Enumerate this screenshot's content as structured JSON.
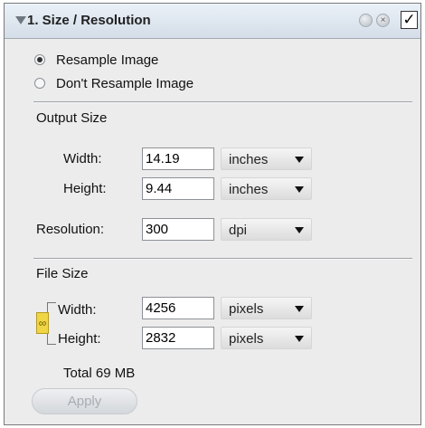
{
  "panel": {
    "title": "1. Size / Resolution",
    "close_glyph": "×",
    "enable_check": "✓"
  },
  "resample": {
    "options": [
      {
        "label": "Resample Image",
        "selected": true
      },
      {
        "label": "Don't Resample Image",
        "selected": false
      }
    ]
  },
  "output_size": {
    "label": "Output Size",
    "width": {
      "label": "Width:",
      "value": "14.19",
      "unit": "inches"
    },
    "height": {
      "label": "Height:",
      "value": "9.44",
      "unit": "inches"
    }
  },
  "resolution": {
    "label": "Resolution:",
    "value": "300",
    "unit": "dpi"
  },
  "file_size": {
    "label": "File Size",
    "width": {
      "label": "Width:",
      "value": "4256",
      "unit": "pixels"
    },
    "height": {
      "label": "Height:",
      "value": "2832",
      "unit": "pixels"
    },
    "total": "Total 69 MB"
  },
  "apply_label": "Apply",
  "colors": {
    "titlebar": "#dde5ee",
    "panel_bg": "#ececec",
    "link_icon": "#f0d545"
  }
}
